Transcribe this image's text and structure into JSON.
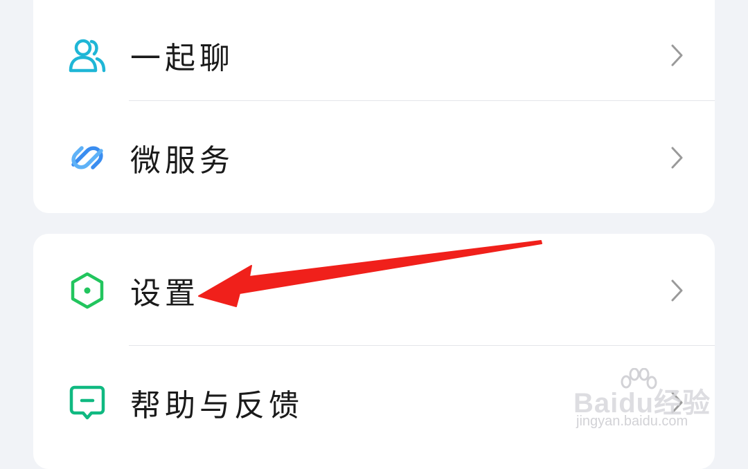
{
  "menu_group_1": {
    "items": [
      {
        "label": "一起聊",
        "icon": "people-icon",
        "icon_color": "#1fb6d6"
      },
      {
        "label": "微服务",
        "icon": "link-icon",
        "icon_color": "#3a8df0"
      }
    ]
  },
  "menu_group_2": {
    "items": [
      {
        "label": "设置",
        "icon": "hexagon-settings-icon",
        "icon_color": "#22c55e"
      },
      {
        "label": "帮助与反馈",
        "icon": "chat-feedback-icon",
        "icon_color": "#10b981"
      }
    ]
  },
  "annotation": {
    "arrow_color": "#f0201b",
    "points_to": "设置"
  },
  "watermark": {
    "brand": "Baidu经验",
    "url": "jingyan.baidu.com"
  },
  "colors": {
    "background": "#f1f3f7",
    "card": "#ffffff",
    "text": "#1a1a1a",
    "chevron": "#9a9a9a",
    "divider": "#e3e5e9"
  }
}
